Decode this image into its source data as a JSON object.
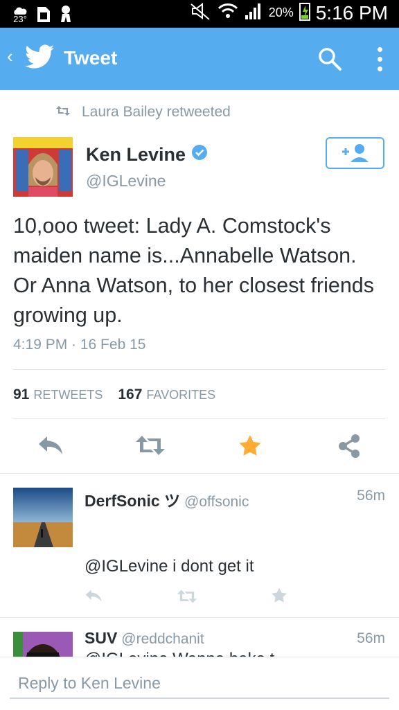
{
  "status_bar": {
    "temperature": "23°",
    "battery": "20%",
    "time": "5:16 PM"
  },
  "app_bar": {
    "title": "Tweet",
    "back_icon": "chevron-left-icon",
    "search_icon": "search-icon",
    "more_icon": "more-vertical-icon"
  },
  "retweet_context": {
    "text": "Laura Bailey retweeted"
  },
  "tweet": {
    "author_name": "Ken Levine",
    "verified": true,
    "author_handle": "@IGLevine",
    "text": "10,ooo tweet: Lady A. Comstock's maiden name is...Annabelle Watson. Or Anna Watson, to her closest friends growing up.",
    "timestamp": "4:19 PM · 16 Feb 15",
    "retweets": {
      "count": "91",
      "label": "RETWEETS"
    },
    "favorites": {
      "count": "167",
      "label": "FAVORITES"
    },
    "favorited": true
  },
  "replies": [
    {
      "name": "DerfSonic ツ",
      "handle": "@offsonic",
      "time": "56m",
      "text": "@IGLevine i dont get it"
    },
    {
      "name": "SUV",
      "handle": "@reddchanit",
      "time": "56m",
      "text": "@IGLevine Wanna bake t..."
    }
  ],
  "reply_box": {
    "placeholder": "Reply to Ken Levine"
  },
  "colors": {
    "brand": "#55acee",
    "favorite": "#ffac33",
    "muted": "#8899a6",
    "text": "#292f33"
  }
}
